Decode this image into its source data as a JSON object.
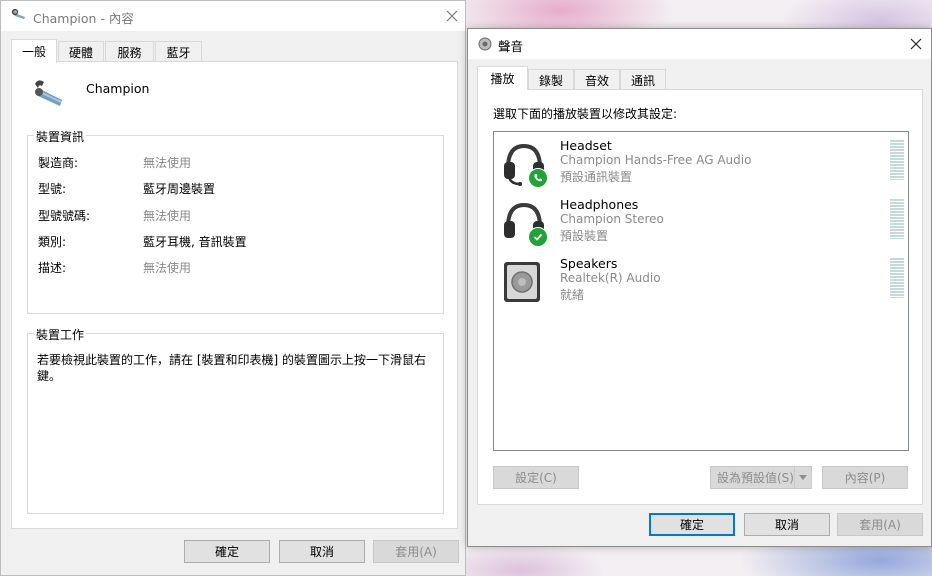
{
  "properties_window": {
    "title": "Champion - 內容",
    "tabs": [
      "一般",
      "硬體",
      "服務",
      "藍牙"
    ],
    "device_name": "Champion",
    "info_group_title": "裝置資訊",
    "info_rows": [
      {
        "label": "製造商:",
        "value": "無法使用",
        "muted": true
      },
      {
        "label": "型號:",
        "value": "藍牙周邊裝置",
        "muted": false
      },
      {
        "label": "型號號碼:",
        "value": "無法使用",
        "muted": true
      },
      {
        "label": "類別:",
        "value": "藍牙耳機, 音訊裝置",
        "muted": false
      },
      {
        "label": "描述:",
        "value": "無法使用",
        "muted": true
      }
    ],
    "tasks_group_title": "裝置工作",
    "tasks_text": "若要檢視此裝置的工作，請在 [裝置和印表機] 的裝置圖示上按一下滑鼠右鍵。",
    "buttons": {
      "ok": "確定",
      "cancel": "取消",
      "apply": "套用(A)"
    }
  },
  "sound_window": {
    "title": "聲音",
    "tabs": [
      "播放",
      "錄製",
      "音效",
      "通訊"
    ],
    "instruction": "選取下面的播放裝置以修改其設定:",
    "devices": [
      {
        "name": "Headset",
        "description": "Champion Hands-Free AG Audio",
        "status": "預設通訊裝置",
        "icon": "headset-icon",
        "badge": "phone-badge-icon"
      },
      {
        "name": "Headphones",
        "description": "Champion Stereo",
        "status": "預設裝置",
        "icon": "headphones-icon",
        "badge": "check-badge-icon"
      },
      {
        "name": "Speakers",
        "description": "Realtek(R) Audio",
        "status": "就緒",
        "icon": "speaker-icon",
        "badge": ""
      }
    ],
    "configure_button": "設定(C)",
    "set_default_button": "設為預設值(S)",
    "properties_button": "內容(P)",
    "buttons": {
      "ok": "確定",
      "cancel": "取消",
      "apply": "套用(A)"
    }
  },
  "colors": {
    "accent": "#0078d7",
    "badge_green": "#22a33a",
    "meter": "#c4d9dc"
  }
}
